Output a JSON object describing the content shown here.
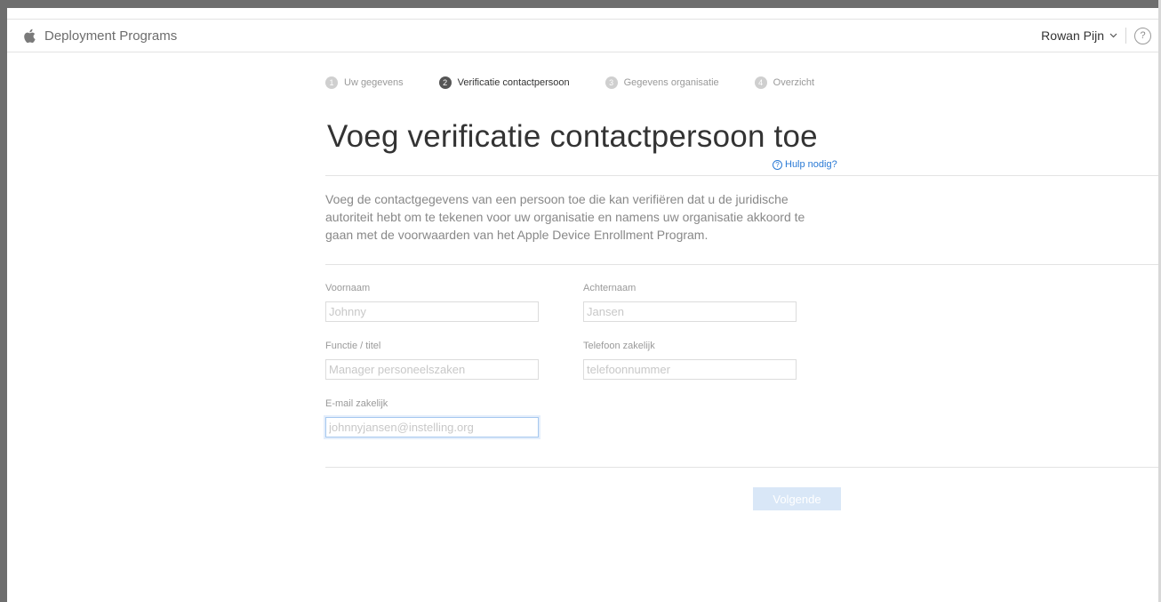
{
  "header": {
    "app_title": "Deployment Programs",
    "user_name": "Rowan Pijn",
    "help_symbol": "?"
  },
  "steps": [
    {
      "number": "1",
      "label": "Uw gegevens",
      "active": false
    },
    {
      "number": "2",
      "label": "Verificatie contactpersoon",
      "active": true
    },
    {
      "number": "3",
      "label": "Gegevens organisatie",
      "active": false
    },
    {
      "number": "4",
      "label": "Overzicht",
      "active": false
    }
  ],
  "page": {
    "heading": "Voeg verificatie contactpersoon toe",
    "help_link": "Hulp nodig?",
    "help_link_icon": "?",
    "intro": "Voeg de contactgegevens van een persoon toe die kan verifiëren dat u de juridische autoriteit hebt om te tekenen voor uw organisatie en namens uw organisatie akkoord te gaan met de voorwaarden van het Apple Device Enrollment Program."
  },
  "form": {
    "first_name": {
      "label": "Voornaam",
      "placeholder": "Johnny",
      "value": ""
    },
    "last_name": {
      "label": "Achternaam",
      "placeholder": "Jansen",
      "value": ""
    },
    "job_title": {
      "label": "Functie / titel",
      "placeholder": "Manager personeelszaken",
      "value": ""
    },
    "phone": {
      "label": "Telefoon zakelijk",
      "placeholder": "telefoonnummer",
      "value": ""
    },
    "email": {
      "label": "E-mail zakelijk",
      "placeholder": "johnnyjansen@instelling.org",
      "value": ""
    }
  },
  "actions": {
    "next_label": "Volgende"
  },
  "icons": {
    "logo": "apple-logo-icon",
    "user_menu": "chevron-down-icon",
    "help": "help-circle-icon"
  },
  "colors": {
    "link": "#2a7ad5",
    "button_disabled_bg": "#d9e7f7",
    "active_step": "#555555",
    "inactive_step": "#cfcfcf"
  }
}
